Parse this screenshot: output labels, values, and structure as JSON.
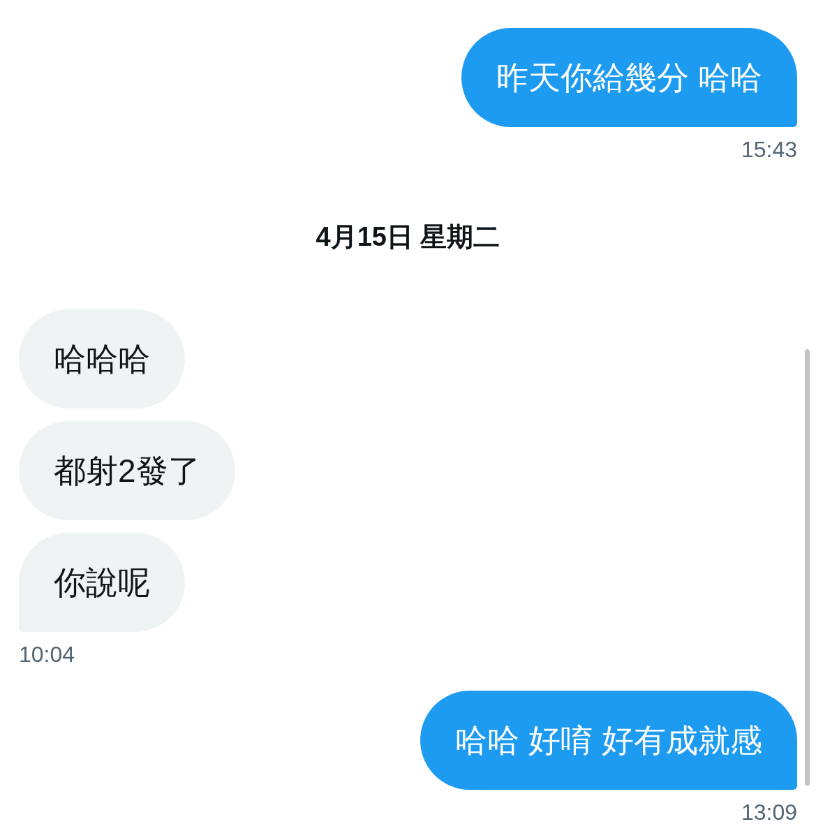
{
  "conversation": [
    {
      "kind": "sent",
      "messages": [
        "昨天你給幾分 哈哈"
      ],
      "time": "15:43"
    },
    {
      "kind": "date",
      "label": "4月15日 星期二"
    },
    {
      "kind": "received",
      "messages": [
        "哈哈哈",
        "都射2發了",
        "你說呢"
      ],
      "time": "10:04"
    },
    {
      "kind": "sent",
      "messages": [
        "哈哈 好唷 好有成就感"
      ],
      "time": "13:09"
    }
  ]
}
